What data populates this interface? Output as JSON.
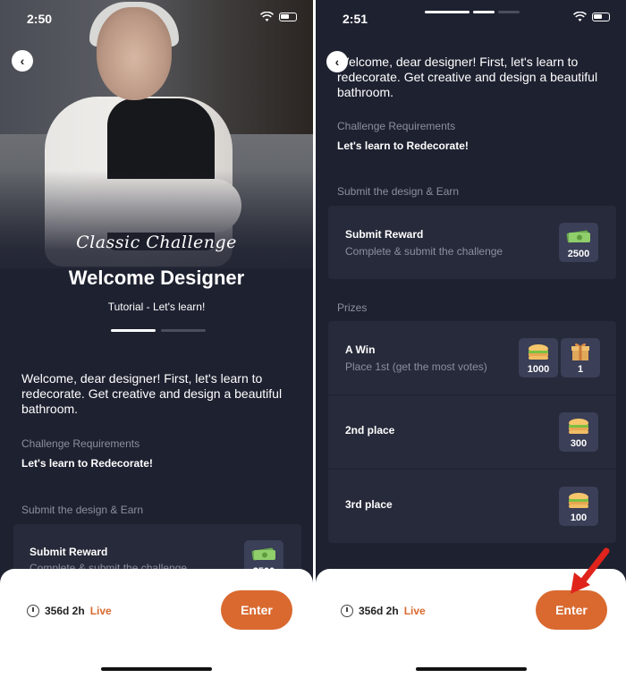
{
  "left": {
    "status_time": "2:50",
    "script_title": "Classic Challenge",
    "title": "Welcome Designer",
    "subtitle": "Tutorial - Let's learn!",
    "intro": "Welcome, dear designer! First, let's learn to redecorate. Get creative and design a beautiful bathroom.",
    "requirements_label": "Challenge Requirements",
    "requirements_value": "Let's learn to Redecorate!",
    "submit_label": "Submit the design & Earn",
    "submit_card": {
      "title": "Submit Reward",
      "subtitle": "Complete & submit the challenge",
      "badge": "2500"
    },
    "timer": "356d 2h",
    "live": "Live",
    "enter": "Enter"
  },
  "right": {
    "status_time": "2:51",
    "intro": "Welcome, dear designer! First, let's learn to redecorate. Get creative and design a beautiful bathroom.",
    "requirements_label": "Challenge Requirements",
    "requirements_value": "Let's learn to Redecorate!",
    "submit_label": "Submit the design & Earn",
    "submit_card": {
      "title": "Submit Reward",
      "subtitle": "Complete & submit the challenge",
      "badge": "2500"
    },
    "prizes_label": "Prizes",
    "prizes": [
      {
        "title": "A Win",
        "subtitle": "Place 1st (get the most votes)",
        "badges": [
          "1000",
          "1"
        ]
      },
      {
        "title": "2nd place",
        "badges": [
          "300"
        ]
      },
      {
        "title": "3rd place",
        "badges": [
          "100"
        ]
      }
    ],
    "timer": "356d 2h",
    "live": "Live",
    "enter": "Enter"
  },
  "colors": {
    "background": "#1e2130",
    "card": "#272a3a",
    "badge": "#3b3f57",
    "accent": "#d9692f",
    "muted": "#8b8fa0"
  }
}
